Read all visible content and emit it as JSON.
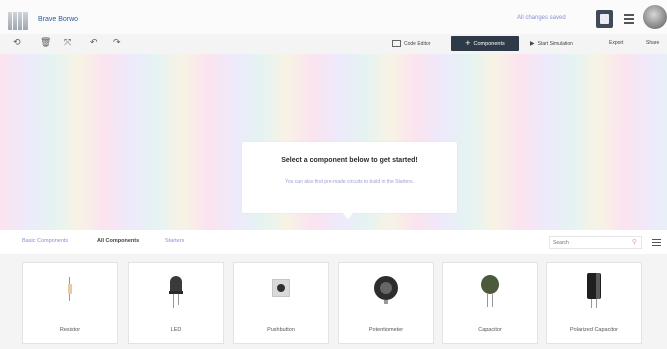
{
  "topbar": {
    "design_name": "Brave Borwo",
    "saved_status": "All changes saved"
  },
  "toolbar": {
    "code_editor_label": "Code Editor",
    "components_label": "Components",
    "start_simulation_label": "Start Simulation",
    "export_label": "Export",
    "share_label": "Share"
  },
  "workplane": {
    "tip_title": "Select a component below to get started!",
    "tip_text": "You can also find pre-made circuits to build in the Starters."
  },
  "panel": {
    "tabs": [
      {
        "label": "Basic Components"
      },
      {
        "label": "All Components"
      },
      {
        "label": "Starters"
      }
    ],
    "search_placeholder": "Search"
  },
  "components": [
    {
      "name": "Resistor"
    },
    {
      "name": "LED"
    },
    {
      "name": "Pushbutton"
    },
    {
      "name": "Potentiometer"
    },
    {
      "name": "Capacitor"
    },
    {
      "name": "Polarized Capacitor"
    }
  ],
  "colors": {
    "accent_dark": "#2f3a48",
    "link_blue": "#2d5aa0",
    "hint_purple": "#8a8fd6"
  }
}
